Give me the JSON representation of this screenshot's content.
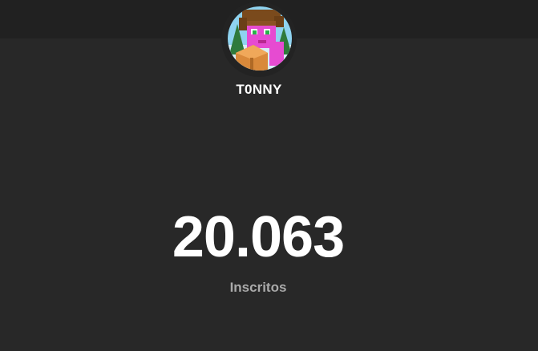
{
  "channel": {
    "name": "T0NNY",
    "avatar_icon": "minecraft-character-avatar"
  },
  "stats": {
    "subscriber_count": "20.063",
    "subscriber_label": "Inscritos"
  },
  "colors": {
    "background": "#282828",
    "top_bar": "#212121",
    "text_primary": "#ffffff",
    "text_secondary": "#aaaaaa"
  }
}
